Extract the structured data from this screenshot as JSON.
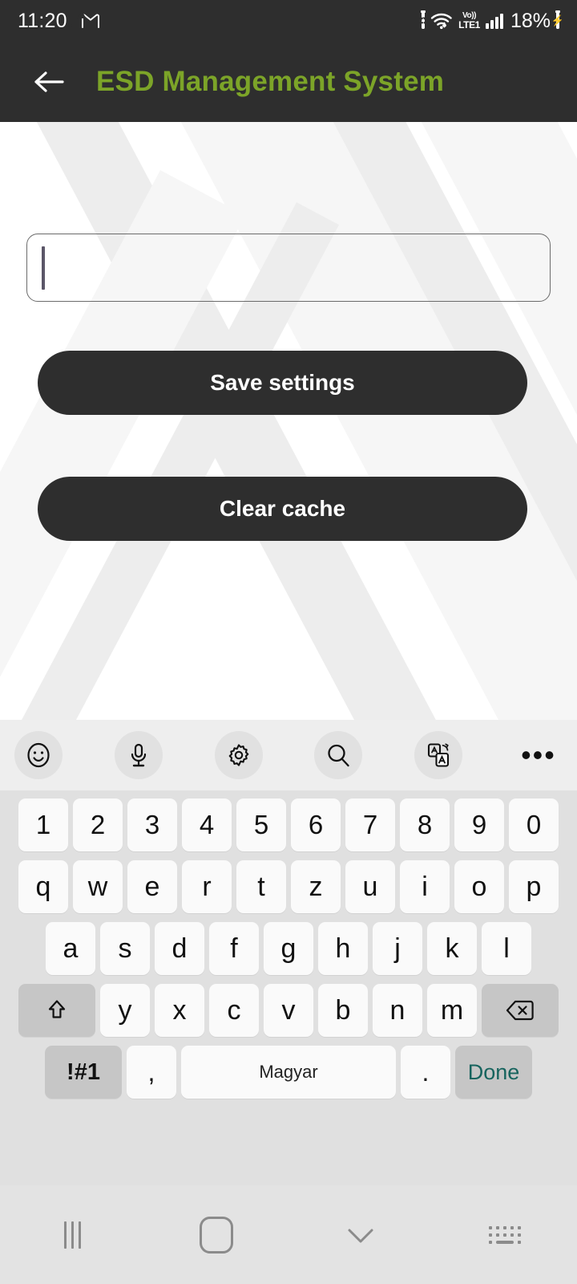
{
  "status_bar": {
    "clock": "11:20",
    "left_icons": [
      "photos-icon",
      "gmail-icon"
    ],
    "right_icons": [
      "battery-saver-icon",
      "wifi-icon",
      "volte-icon",
      "signal-bars-icon"
    ],
    "volte_top": "Vo))",
    "volte_bottom": "LTE1",
    "battery_percent": "18%",
    "battery_charging": true
  },
  "app_bar": {
    "back_icon": "arrow-left-icon",
    "title": "ESD Management System",
    "title_color": "#7CA428",
    "bg_color": "#2E2E2E"
  },
  "content": {
    "text_field": {
      "value": "",
      "placeholder": "",
      "focused": true
    },
    "buttons": {
      "save_label": "Save settings",
      "clear_label": "Clear cache",
      "bg_color": "#2E2E2E",
      "text_color": "#FFFFFF"
    }
  },
  "keyboard": {
    "toolbar": [
      {
        "name": "emoji-icon",
        "glyph": "emoji"
      },
      {
        "name": "microphone-icon",
        "glyph": "mic"
      },
      {
        "name": "gear-icon",
        "glyph": "gear"
      },
      {
        "name": "search-icon",
        "glyph": "search"
      },
      {
        "name": "translate-icon",
        "glyph": "translate"
      },
      {
        "name": "overflow-menu-icon",
        "glyph": "•••"
      }
    ],
    "rows": {
      "numbers": [
        "1",
        "2",
        "3",
        "4",
        "5",
        "6",
        "7",
        "8",
        "9",
        "0"
      ],
      "row1": [
        "q",
        "w",
        "e",
        "r",
        "t",
        "z",
        "u",
        "i",
        "o",
        "p"
      ],
      "row2": [
        "a",
        "s",
        "d",
        "f",
        "g",
        "h",
        "j",
        "k",
        "l"
      ],
      "row3_letters": [
        "y",
        "x",
        "c",
        "v",
        "b",
        "n",
        "m"
      ],
      "shift_key": "shift-key",
      "backspace_key": "backspace-key"
    },
    "bottom_row": {
      "symbols_label": "!#1",
      "comma_label": ",",
      "space_label": "Magyar",
      "period_label": ".",
      "done_label": "Done",
      "done_color": "#17645E"
    },
    "bg_color": "#E0E0E0",
    "key_color": "#FAFAFA",
    "mod_key_color": "#C6C6C6"
  },
  "nav_bar": {
    "items": [
      {
        "name": "recents-button",
        "icon": "recents-icon"
      },
      {
        "name": "home-button",
        "icon": "home-icon"
      },
      {
        "name": "hide-keyboard-button",
        "icon": "chevron-down-icon"
      },
      {
        "name": "switch-keyboard-button",
        "icon": "keyboard-icon"
      }
    ]
  }
}
